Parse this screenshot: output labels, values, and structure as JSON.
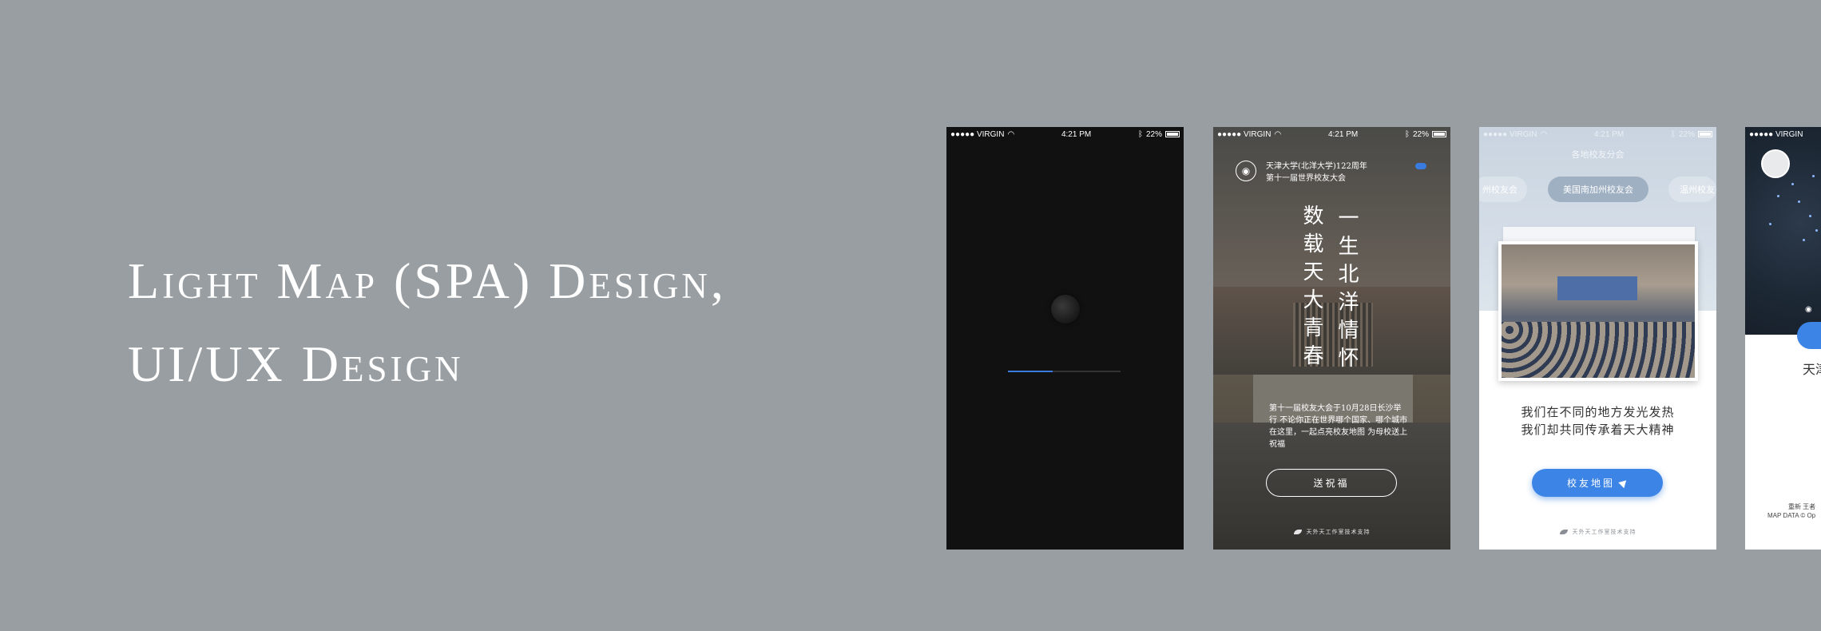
{
  "title": {
    "line1": "Light Map (SPA) Design,",
    "line2": "UI/UX Design"
  },
  "statusbar": {
    "carrier": "●●●●● VIRGIN",
    "time": "4:21 PM",
    "battery": "22%"
  },
  "loading": {
    "progress": 0.4
  },
  "poster": {
    "header_line1": "天津大学(北洋大学)122周年",
    "header_line2": "第十一届世界校友大会",
    "verse_col1": "一生北洋情怀",
    "verse_col2": "数载天大青春",
    "caption": "第十一届校友大会于10月28日长沙举行 不论你正在世界哪个国家、哪个城市 在这里，一起点亮校友地图 为母校送上祝福",
    "button": "送祝福",
    "footer": "天外天工作室技术支持"
  },
  "alumni": {
    "heading": "各地校友分会",
    "chips": [
      "州校友会",
      "美国南加州校友会",
      "温州校友"
    ],
    "text_line1": "我们在不同的地方发光发热",
    "text_line2": "我们却共同传承着天大精神",
    "button": "校友地图",
    "footer": "天外天工作室技术支持"
  },
  "map": {
    "label": "天津",
    "credit_line1": "重新 王者",
    "credit_line2": "MAP DATA © Op"
  },
  "colors": {
    "background": "#999ea2",
    "accent": "#3c84e6"
  },
  "icons": [
    "wifi-icon",
    "bluetooth-icon",
    "globe-icon",
    "seal-icon",
    "leaf-icon",
    "send-icon",
    "avatar-icon"
  ]
}
